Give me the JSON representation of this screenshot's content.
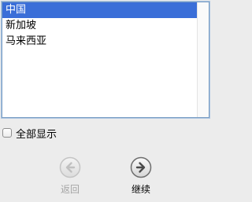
{
  "list": {
    "items": [
      {
        "label": "中国",
        "selected": true
      },
      {
        "label": "新加坡",
        "selected": false
      },
      {
        "label": "马来西亚",
        "selected": false
      }
    ]
  },
  "show_all": {
    "label": "全部显示",
    "checked": false
  },
  "nav": {
    "back": {
      "label": "返回",
      "icon": "arrow-left-circle-icon",
      "enabled": false
    },
    "next": {
      "label": "继续",
      "icon": "arrow-right-circle-icon",
      "enabled": true
    }
  },
  "colors": {
    "selection": "#3a6ed8",
    "background": "#ececec",
    "disabled_text": "#a5a5a5"
  }
}
